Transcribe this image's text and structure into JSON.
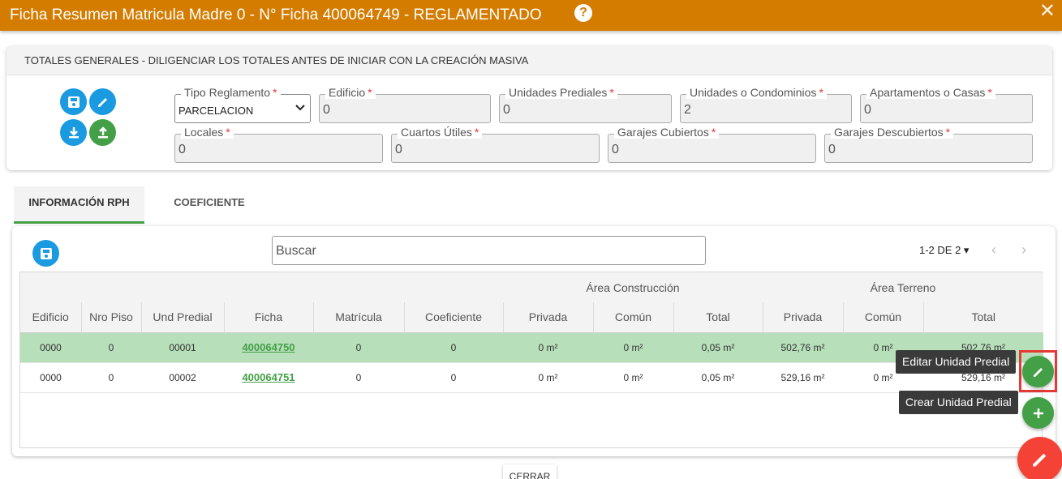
{
  "header": {
    "title": "Ficha Resumen Matricula Madre 0 - N° Ficha 400064749 - REGLAMENTADO",
    "help_icon": "question-circle-icon",
    "close_icon": "close-icon",
    "color": "#d47c00"
  },
  "totals": {
    "heading": "TOTALES GENERALES - DILIGENCIAR LOS TOTALES ANTES DE INICIAR CON LA CREACIÓN MASIVA",
    "required_mark": "*",
    "fields": {
      "tipo_reglamento": {
        "label": "Tipo Reglamento",
        "value": "PARCELACION"
      },
      "edificio": {
        "label": "Edificio",
        "value": "0"
      },
      "unidades_prediales": {
        "label": "Unidades Prediales",
        "value": "0"
      },
      "unidades_condominios": {
        "label": "Unidades o Condominios",
        "value": "2"
      },
      "apartamentos_casas": {
        "label": "Apartamentos o Casas",
        "value": "0"
      },
      "locales": {
        "label": "Locales",
        "value": "0"
      },
      "cuartos_utiles": {
        "label": "Cuartos Útiles",
        "value": "0"
      },
      "garajes_cubiertos": {
        "label": "Garajes Cubiertos",
        "value": "0"
      },
      "garajes_descubiertos": {
        "label": "Garajes Descubiertos",
        "value": "0"
      }
    }
  },
  "tabs": [
    {
      "label": "INFORMACIÓN RPH",
      "active": true
    },
    {
      "label": "COEFICIENTE",
      "active": false
    }
  ],
  "toolbar": {
    "search_placeholder": "Buscar",
    "pager": "1-2 DE 2"
  },
  "table": {
    "groups": {
      "construccion": "Área Construcción",
      "terreno": "Área Terreno"
    },
    "columns": [
      "Edificio",
      "Nro Piso",
      "Und Predial",
      "Ficha",
      "Matrícula",
      "Coeficiente",
      "Privada",
      "Común",
      "Total",
      "Privada",
      "Común",
      "Total"
    ],
    "rows": [
      {
        "edificio": "0000",
        "piso": "0",
        "und": "00001",
        "ficha": "400064750",
        "matricula": "0",
        "coef": "0",
        "c_priv": "0 m²",
        "c_com": "0 m²",
        "c_tot": "0,05 m²",
        "t_priv": "502,76 m²",
        "t_com": "0 m²",
        "t_tot": "502,76 m²",
        "selected": true
      },
      {
        "edificio": "0000",
        "piso": "0",
        "und": "00002",
        "ficha": "400064751",
        "matricula": "0",
        "coef": "0",
        "c_priv": "0 m²",
        "c_com": "0 m²",
        "c_tot": "0,05 m²",
        "t_priv": "529,16 m²",
        "t_com": "0 m²",
        "t_tot": "529,16 m²",
        "selected": false
      }
    ]
  },
  "tooltips": {
    "edit": "Editar Unidad Predial",
    "create": "Crear Unidad Predial"
  },
  "footer": {
    "close_label": "CERRAR"
  },
  "colors": {
    "accent_green": "#43a047",
    "accent_blue": "#1a9ae0",
    "danger_red": "#f44336"
  }
}
